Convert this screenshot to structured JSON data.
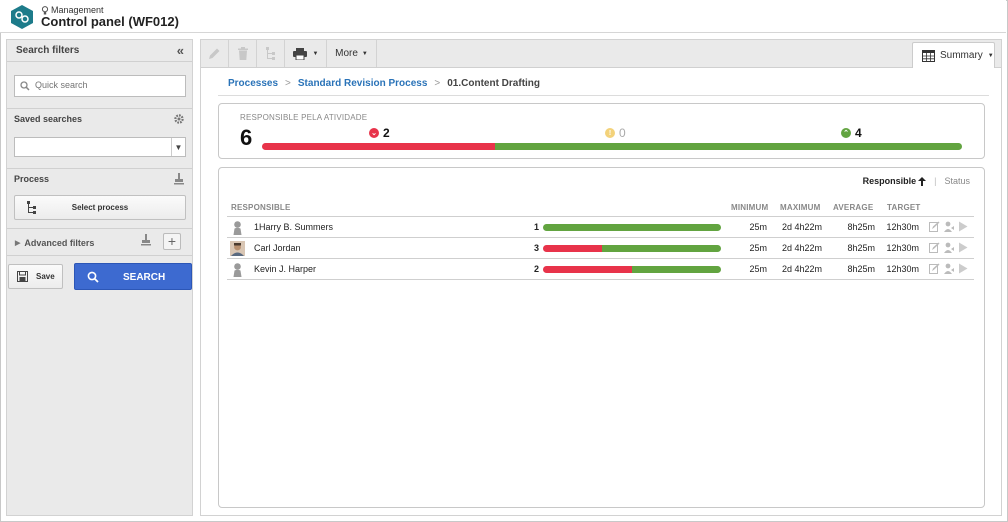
{
  "header": {
    "section": "Management",
    "title": "Control panel (WF012)"
  },
  "sidebar": {
    "title": "Search filters",
    "quick_search_placeholder": "Quick search",
    "saved_searches_label": "Saved searches",
    "saved_searches_value": "",
    "process_label": "Process",
    "select_process_label": "Select process",
    "advanced_filters_label": "Advanced filters",
    "save_label": "Save",
    "search_label": "SEARCH"
  },
  "toolbar": {
    "more_label": "More",
    "summary_label": "Summary"
  },
  "breadcrumb": {
    "items": [
      "Processes",
      "Standard Revision Process",
      "01.Content Drafting"
    ],
    "separator": ">"
  },
  "summary": {
    "caption": "RESPONSIBLE PELA ATIVIDADE",
    "total": "6",
    "overdue": "2",
    "warning": "0",
    "on_time": "4",
    "overdue_fraction": 0.333
  },
  "sort": {
    "active": "Responsible",
    "inactive": "Status"
  },
  "table": {
    "headers": {
      "responsible": "RESPONSIBLE",
      "minimum": "MINIMUM",
      "maximum": "MAXIMUM",
      "average": "AVERAGE",
      "target": "TARGET"
    },
    "rows": [
      {
        "name": "1Harry B. Summers",
        "count": "1",
        "overdue_fraction": 0.0,
        "minimum": "25m",
        "maximum": "2d 4h22m",
        "average": "8h25m",
        "target": "12h30m",
        "avatar": "silhouette-icon"
      },
      {
        "name": "Carl Jordan",
        "count": "3",
        "overdue_fraction": 0.333,
        "minimum": "25m",
        "maximum": "2d 4h22m",
        "average": "8h25m",
        "target": "12h30m",
        "avatar": "photo"
      },
      {
        "name": "Kevin J. Harper",
        "count": "2",
        "overdue_fraction": 0.5,
        "minimum": "25m",
        "maximum": "2d 4h22m",
        "average": "8h25m",
        "target": "12h30m",
        "avatar": "silhouette-icon"
      }
    ]
  },
  "colors": {
    "overdue": "#e8334a",
    "warning": "#f3d27a",
    "on_time": "#62a440",
    "link": "#2a73b8",
    "search_button": "#3d6ad0",
    "brand": "#1d7b8a"
  }
}
